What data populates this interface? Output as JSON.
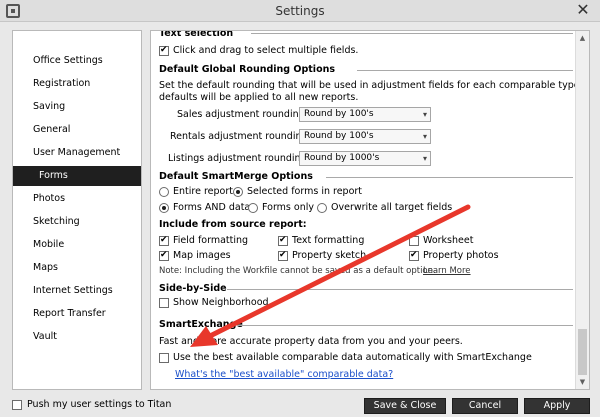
{
  "window": {
    "title": "Settings"
  },
  "sidebar": {
    "items": [
      {
        "label": "Office Settings"
      },
      {
        "label": "Registration"
      },
      {
        "label": "Saving"
      },
      {
        "label": "General"
      },
      {
        "label": "User Management"
      },
      {
        "label": "Forms",
        "active": true
      },
      {
        "label": "Photos"
      },
      {
        "label": "Sketching"
      },
      {
        "label": "Mobile"
      },
      {
        "label": "Maps"
      },
      {
        "label": "Internet Settings"
      },
      {
        "label": "Report Transfer"
      },
      {
        "label": "Vault"
      }
    ]
  },
  "content": {
    "text_selection": {
      "heading": "Text selection",
      "click_drag_label": "Click and drag to select multiple fields."
    },
    "rounding": {
      "heading": "Default Global Rounding Options",
      "description_line1": "Set the default rounding that will be used in adjustment fields for each comparable type below.  These",
      "description_line2": "defaults will be applied to all new reports.",
      "sales_label": "Sales adjustment rounding:",
      "sales_value": "Round by 100's",
      "rentals_label": "Rentals adjustment rounding:",
      "rentals_value": "Round by 100's",
      "listings_label": "Listings adjustment rounding:",
      "listings_value": "Round by 1000's"
    },
    "smartmerge": {
      "heading": "Default SmartMerge Options",
      "entire_report": "Entire report",
      "selected_forms": "Selected forms in report",
      "forms_and_data": "Forms AND data",
      "forms_only": "Forms only",
      "overwrite": "Overwrite all target fields",
      "include_heading": "Include from source report:",
      "field_formatting": "Field formatting",
      "text_formatting": "Text formatting",
      "worksheet": "Worksheet",
      "map_images": "Map images",
      "property_sketch": "Property sketch",
      "property_photos": "Property photos",
      "note": "Note: Including the Workfile cannot be saved as a default option.",
      "learn_more": "Learn More"
    },
    "side_by_side": {
      "heading": "Side-by-Side",
      "show_neighborhood": "Show Neighborhood"
    },
    "smartexchange": {
      "heading": "SmartExchange",
      "description": "Fast and more accurate property data from you and your peers.",
      "use_best": "Use the best available comparable data automatically with SmartExchange",
      "link": "What's the \"best available\" comparable data?"
    }
  },
  "footer": {
    "push_label": "Push my user settings to Titan",
    "save_close": "Save & Close",
    "cancel": "Cancel",
    "apply": "Apply"
  },
  "colors": {
    "active_nav": "#1f1f1f",
    "link": "#1a4fc9",
    "annotation_arrow": "#e8372b"
  }
}
